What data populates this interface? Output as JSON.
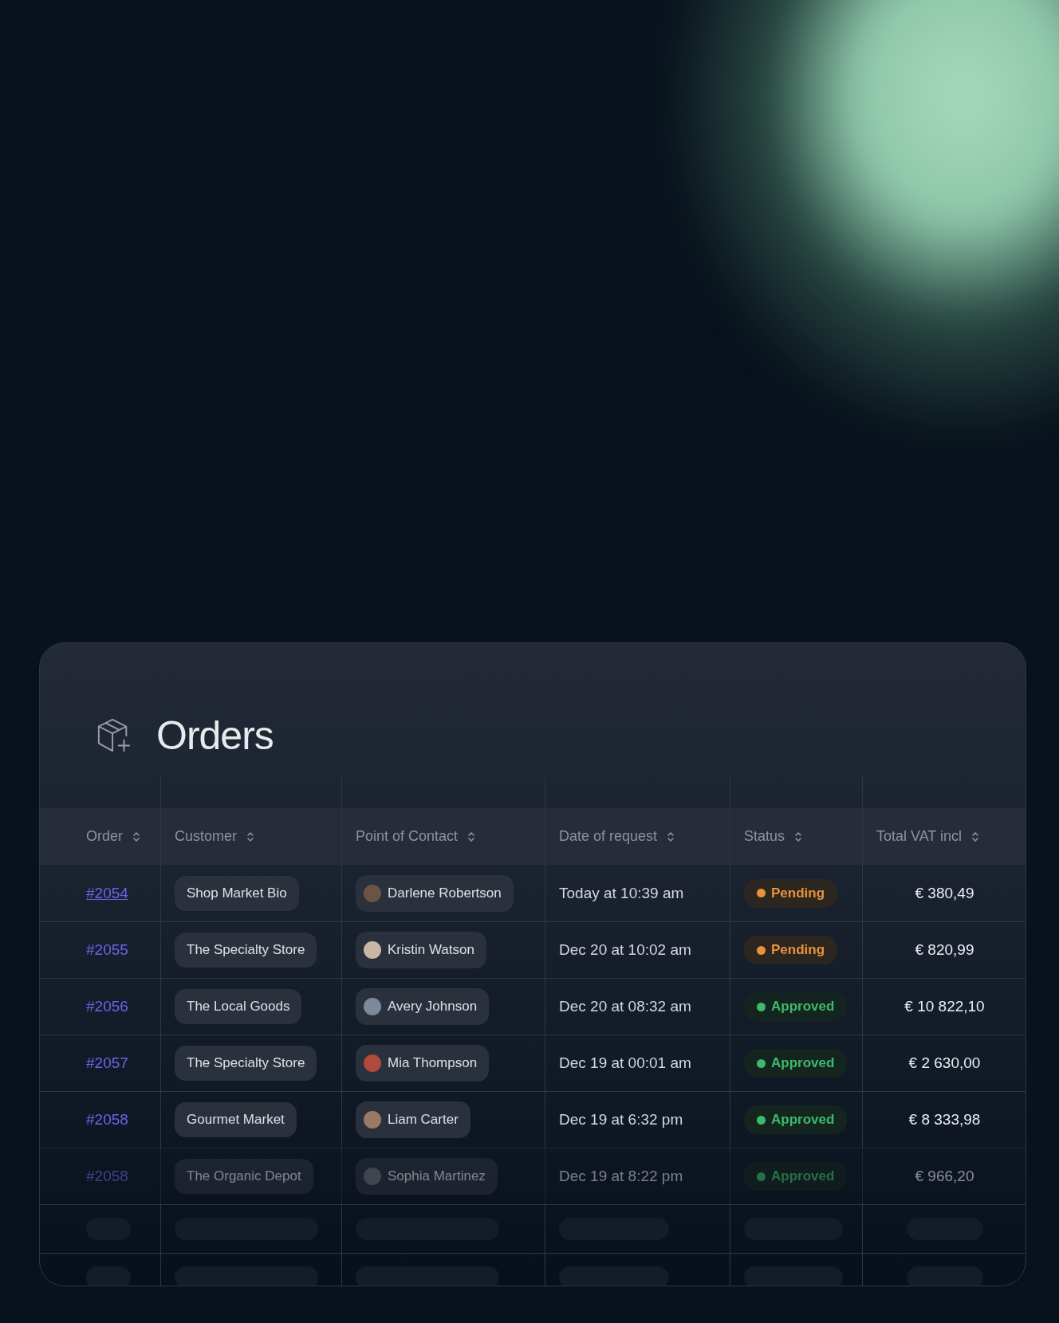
{
  "title": "Orders",
  "columns": [
    "Order",
    "Customer",
    "Point of Contact",
    "Date of request",
    "Status",
    "Total VAT incl"
  ],
  "rows": [
    {
      "order": "#2054",
      "underlined": true,
      "faded": false,
      "customer": "Shop Market Bio",
      "contact": "Darlene Robertson",
      "date": "Today at 10:39 am",
      "status": {
        "kind": "pending",
        "label": "Pending"
      },
      "total": "€ 380,49"
    },
    {
      "order": "#2055",
      "underlined": false,
      "faded": false,
      "customer": "The Specialty Store",
      "contact": "Kristin Watson",
      "date": "Dec 20 at 10:02 am",
      "status": {
        "kind": "pending",
        "label": "Pending"
      },
      "total": "€ 820,99"
    },
    {
      "order": "#2056",
      "underlined": false,
      "faded": false,
      "customer": "The Local Goods",
      "contact": "Avery Johnson",
      "date": "Dec 20 at 08:32 am",
      "status": {
        "kind": "approved",
        "label": "Approved"
      },
      "total": "€ 10 822,10"
    },
    {
      "order": "#2057",
      "underlined": false,
      "faded": false,
      "customer": "The Specialty Store",
      "contact": "Mia Thompson",
      "date": "Dec 19 at 00:01 am",
      "status": {
        "kind": "approved",
        "label": "Approved"
      },
      "total": "€ 2 630,00"
    },
    {
      "order": "#2058",
      "underlined": false,
      "faded": false,
      "customer": "Gourmet Market",
      "contact": "Liam Carter",
      "date": "Dec 19 at 6:32 pm",
      "status": {
        "kind": "approved",
        "label": "Approved"
      },
      "total": "€ 8 333,98"
    },
    {
      "order": "#2058",
      "underlined": false,
      "faded": true,
      "customer": "The Organic Depot",
      "contact": "Sophia Martinez",
      "date": "Dec 19 at 8:22 pm",
      "status": {
        "kind": "approved",
        "label": "Approved"
      },
      "total": "€ 966,20"
    }
  ]
}
